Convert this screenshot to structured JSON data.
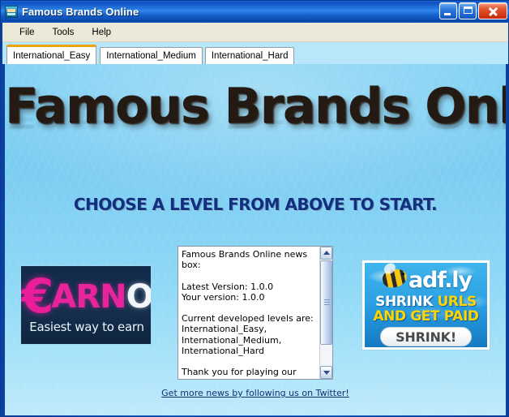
{
  "window": {
    "title": "Famous Brands Online",
    "icon": "app-icon",
    "controls": {
      "minimize": "minimize-button",
      "maximize": "maximize-button",
      "close": "close-button"
    }
  },
  "menu": {
    "items": [
      {
        "label": "File"
      },
      {
        "label": "Tools"
      },
      {
        "label": "Help"
      }
    ]
  },
  "tabs": {
    "items": [
      {
        "label": "International_Easy",
        "active": true
      },
      {
        "label": "International_Medium",
        "active": false
      },
      {
        "label": "International_Hard",
        "active": false
      }
    ],
    "active_accent_color": "#f0a202"
  },
  "hero": {
    "title": "Famous Brands Online",
    "subtitle": "CHOOSE A LEVEL FROM ABOVE TO START.",
    "title_color": "#241a14",
    "subtitle_color": "#12307e",
    "background_color": "#7ed0f3"
  },
  "ads": {
    "left": {
      "name": "EarnOn",
      "symbol": "€",
      "word_primary": "ARN",
      "word_secondary": "ON",
      "tagline": "Easiest way to earn",
      "primary_color": "#e8249c",
      "secondary_color": "#f2f6f8",
      "background_color": "#122a4a"
    },
    "right": {
      "name": "adf.ly",
      "logo_text": "adf.ly",
      "line1_white": "SHRINK ",
      "line1_yellow": "URLS",
      "line2": "AND GET PAID",
      "button_label": "SHRINK!",
      "accent_color": "#ffd400",
      "background_color": "#2da2e4"
    }
  },
  "newsbox": {
    "content": "Famous Brands Online news box:\n\nLatest Version: 1.0.0\nYour version: 1.0.0\n\nCurrent developed levels are:\nInternational_Easy,\nInternational_Medium,\nInternational_Hard\n\nThank you for playing our recently",
    "scrollbar": {
      "up": "scroll-up-arrow",
      "down": "scroll-down-arrow"
    }
  },
  "footer": {
    "twitter_link": "Get more news by following us on Twitter!"
  }
}
